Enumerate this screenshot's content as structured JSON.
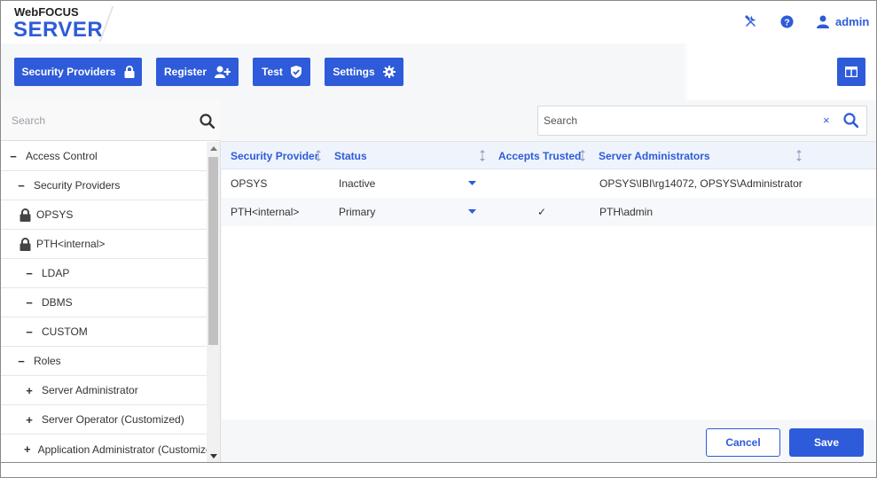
{
  "header": {
    "brand_top": "WebFOCUS",
    "brand_main": "SERVER",
    "user_label": "admin",
    "icons": [
      "tools-icon",
      "help-icon",
      "user-icon"
    ]
  },
  "toolbar": {
    "buttons": [
      {
        "label": "Security Providers",
        "icon": "lock-icon"
      },
      {
        "label": "Register",
        "icon": "add-user-icon"
      },
      {
        "label": "Test",
        "icon": "shield-check-icon"
      },
      {
        "label": "Settings",
        "icon": "gear-icon"
      }
    ],
    "layout_toggle_icon": "panel-layout-icon"
  },
  "left_panel": {
    "search_placeholder": "Search",
    "tree": [
      {
        "label": "Access Control",
        "symbol": "−",
        "level": 0
      },
      {
        "label": "Security Providers",
        "symbol": "−",
        "level": 1
      },
      {
        "label": "OPSYS",
        "symbol": "lock",
        "level": 1
      },
      {
        "label": "PTH<internal>",
        "symbol": "lock",
        "level": 1
      },
      {
        "label": "LDAP",
        "symbol": "−",
        "level": 2
      },
      {
        "label": "DBMS",
        "symbol": "−",
        "level": 2
      },
      {
        "label": "CUSTOM",
        "symbol": "−",
        "level": 2
      },
      {
        "label": "Roles",
        "symbol": "−",
        "level": 1
      },
      {
        "label": "Server Administrator",
        "symbol": "+",
        "level": 2
      },
      {
        "label": "Server Operator (Customized)",
        "symbol": "+",
        "level": 2
      },
      {
        "label": "Application Administrator (Customized)",
        "symbol": "+",
        "level": 2
      }
    ]
  },
  "grid": {
    "search_placeholder": "Search",
    "clear_symbol": "×",
    "columns": [
      "Security Provider",
      "Status",
      "Accepts Trusted",
      "Server Administrators"
    ],
    "rows": [
      {
        "provider": "OPSYS",
        "status": "Inactive",
        "trusted": "",
        "admins": "OPSYS\\IBI\\rg14072, OPSYS\\Administrator"
      },
      {
        "provider": "PTH<internal>",
        "status": "Primary",
        "trusted": "✓",
        "admins": "PTH\\admin"
      }
    ]
  },
  "footer": {
    "cancel_label": "Cancel",
    "save_label": "Save"
  },
  "colors": {
    "accent": "#2e5bd9",
    "header_row": "#eef3fc"
  }
}
